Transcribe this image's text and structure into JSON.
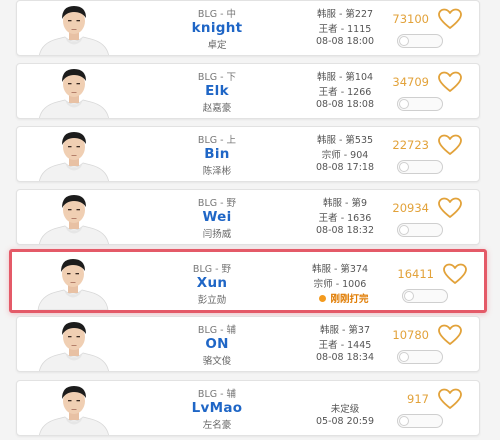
{
  "players": [
    {
      "team_pos": "BLG - 中",
      "name": "knight",
      "realname": "卓定",
      "rank1": "韩服 - 第227",
      "rank2": "王者 - 1115",
      "time": "08-08 18:00",
      "likes": "73100"
    },
    {
      "team_pos": "BLG - 下",
      "name": "Elk",
      "realname": "赵嘉豪",
      "rank1": "韩服 - 第104",
      "rank2": "王者 - 1266",
      "time": "08-08 18:08",
      "likes": "34709"
    },
    {
      "team_pos": "BLG - 上",
      "name": "Bin",
      "realname": "陈泽彬",
      "rank1": "韩服 - 第535",
      "rank2": "宗师 - 904",
      "time": "08-08 17:18",
      "likes": "22723"
    },
    {
      "team_pos": "BLG - 野",
      "name": "Wei",
      "realname": "闫扬威",
      "rank1": "韩服 - 第9",
      "rank2": "王者 - 1636",
      "time": "08-08 18:32",
      "likes": "20934"
    },
    {
      "team_pos": "BLG - 野",
      "name": "Xun",
      "realname": "彭立勋",
      "rank1": "韩服 - 第374",
      "rank2": "宗师 - 1006",
      "status": "刚刚打完",
      "likes": "16411",
      "highlighted": true
    },
    {
      "team_pos": "BLG - 辅",
      "name": "ON",
      "realname": "骆文俊",
      "rank1": "韩服 - 第37",
      "rank2": "王者 - 1445",
      "time": "08-08 18:34",
      "likes": "10780"
    },
    {
      "team_pos": "BLG - 辅",
      "name": "LvMao",
      "realname": "左名豪",
      "rank1": "未定级",
      "time": "05-08 20:59",
      "likes": "917"
    }
  ],
  "colors": {
    "highlight_border": "#e45a68",
    "name_blue": "#1f66c6",
    "likes_gold": "#e2a23a",
    "status_orange": "#e07b00"
  },
  "icons": {
    "like": "heart-outline-icon",
    "status": "orange-dot-icon"
  }
}
